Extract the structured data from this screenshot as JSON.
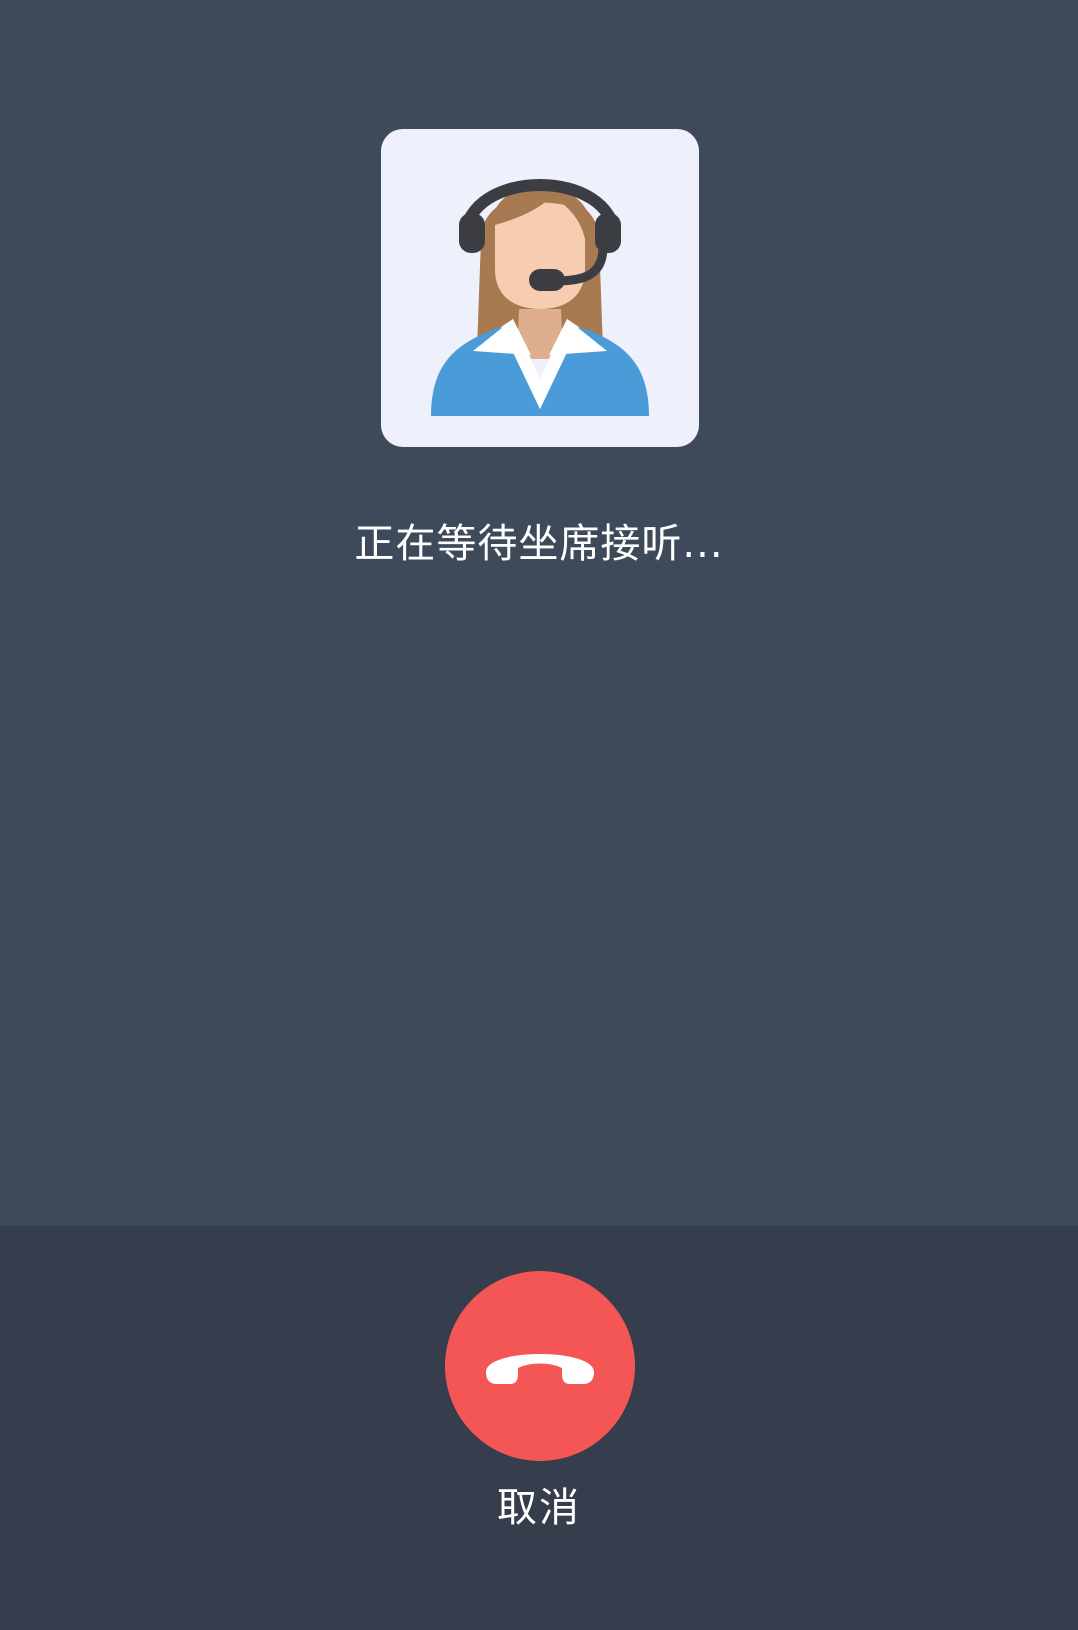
{
  "call": {
    "status_text": "正在等待坐席接听...",
    "cancel_label": "取消"
  },
  "avatar": {
    "icon": "customer-service-agent-icon"
  },
  "hangup": {
    "icon": "hang-up-phone-icon"
  },
  "colors": {
    "background": "#3e4a59",
    "bottom_bar": "#363d4c",
    "hangup_button": "#f45656",
    "avatar_card": "#eef1fc",
    "text": "#ffffff"
  }
}
